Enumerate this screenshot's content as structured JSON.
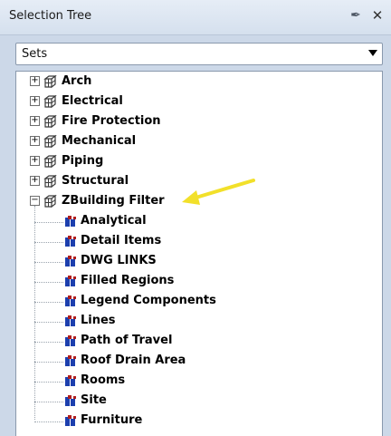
{
  "window": {
    "title": "Selection Tree"
  },
  "header": {
    "pin_icon": "pin-icon",
    "close_icon": "close-icon"
  },
  "dropdown": {
    "value": "Sets"
  },
  "tree": {
    "sets": [
      {
        "label": "Arch",
        "expanded": false
      },
      {
        "label": "Electrical",
        "expanded": false
      },
      {
        "label": "Fire Protection",
        "expanded": false
      },
      {
        "label": "Mechanical",
        "expanded": false
      },
      {
        "label": "Piping",
        "expanded": false
      },
      {
        "label": "Structural",
        "expanded": false
      },
      {
        "label": "ZBuilding Filter",
        "expanded": true
      }
    ],
    "filter_children": [
      {
        "label": "Analytical"
      },
      {
        "label": "Detail Items"
      },
      {
        "label": "DWG LINKS"
      },
      {
        "label": "Filled Regions"
      },
      {
        "label": "Legend Components"
      },
      {
        "label": "Lines"
      },
      {
        "label": "Path of Travel"
      },
      {
        "label": "Roof Drain Area"
      },
      {
        "label": "Rooms"
      },
      {
        "label": "Site"
      },
      {
        "label": "Furniture"
      }
    ]
  },
  "colors": {
    "header_bg": "#dbe5f1",
    "annotation_arrow": "#f2e02a",
    "set_icon": "#3a3a3a",
    "search_icon_blue": "#1c3fae",
    "search_icon_red": "#b01d1d"
  }
}
